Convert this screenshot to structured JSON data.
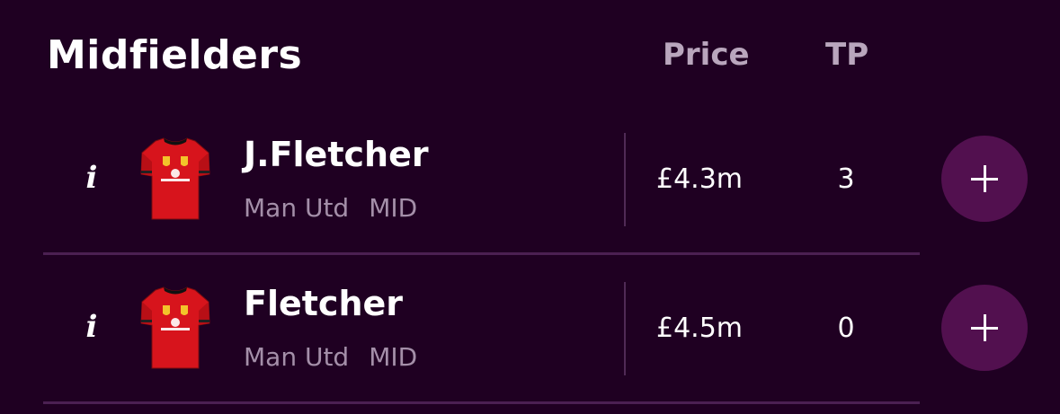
{
  "section": {
    "title": "Midfielders"
  },
  "columns": {
    "price": "Price",
    "tp": "TP"
  },
  "players": [
    {
      "name": "J.Fletcher",
      "team": "Man Utd",
      "position": "MID",
      "price": "£4.3m",
      "tp": "3",
      "info_glyph": "i",
      "kit_icon": "man-utd-shirt-icon",
      "add_icon": "plus-icon"
    },
    {
      "name": "Fletcher",
      "team": "Man Utd",
      "position": "MID",
      "price": "£4.5m",
      "tp": "0",
      "info_glyph": "i",
      "kit_icon": "man-utd-shirt-icon",
      "add_icon": "plus-icon"
    }
  ],
  "colors": {
    "background": "#1f0022",
    "muted_text": "#a48fa9",
    "header_text": "#b9a6bd",
    "add_button": "#52104f",
    "kit_red": "#d7141c",
    "divider": "#4b2052"
  }
}
